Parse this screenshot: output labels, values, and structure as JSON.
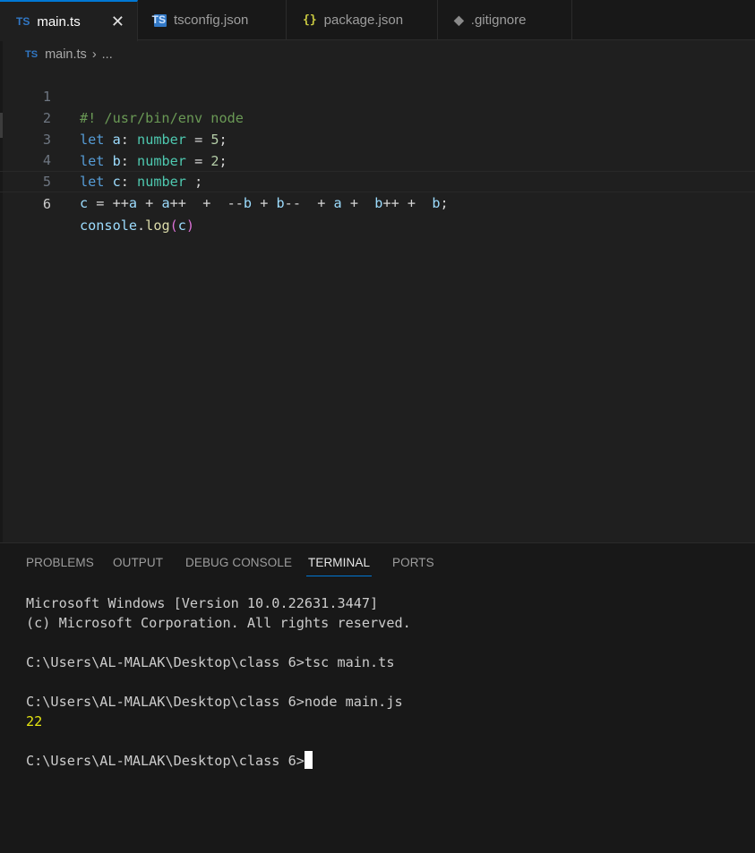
{
  "tabs": [
    {
      "icon": "TS",
      "label": "main.ts",
      "active": true,
      "close": "✕"
    },
    {
      "icon": "TS",
      "label": "tsconfig.json",
      "active": false
    },
    {
      "icon": "{}",
      "label": "package.json",
      "active": false
    },
    {
      "icon": "◆",
      "label": ".gitignore",
      "active": false
    }
  ],
  "breadcrumb": {
    "icon": "TS",
    "file": "main.ts",
    "separator": "›",
    "rest": "..."
  },
  "editor": {
    "line_numbers": [
      "1",
      "2",
      "3",
      "4",
      "5",
      "6"
    ],
    "current_line": "6",
    "lines": [
      [
        {
          "t": "#! /usr/bin/env node",
          "c": "c-comment"
        }
      ],
      [
        {
          "t": "let",
          "c": "c-kw"
        },
        {
          "t": " ",
          "c": ""
        },
        {
          "t": "a",
          "c": "c-var"
        },
        {
          "t": ": ",
          "c": "c-op"
        },
        {
          "t": "number",
          "c": "c-type"
        },
        {
          "t": " = ",
          "c": "c-op"
        },
        {
          "t": "5",
          "c": "c-num"
        },
        {
          "t": ";",
          "c": "c-op"
        }
      ],
      [
        {
          "t": "let",
          "c": "c-kw"
        },
        {
          "t": " ",
          "c": ""
        },
        {
          "t": "b",
          "c": "c-var"
        },
        {
          "t": ": ",
          "c": "c-op"
        },
        {
          "t": "number",
          "c": "c-type"
        },
        {
          "t": " = ",
          "c": "c-op"
        },
        {
          "t": "2",
          "c": "c-num"
        },
        {
          "t": ";",
          "c": "c-op"
        }
      ],
      [
        {
          "t": "let",
          "c": "c-kw"
        },
        {
          "t": " ",
          "c": ""
        },
        {
          "t": "c",
          "c": "c-var"
        },
        {
          "t": ": ",
          "c": "c-op"
        },
        {
          "t": "number",
          "c": "c-type"
        },
        {
          "t": " ;",
          "c": "c-op"
        }
      ],
      [
        {
          "t": "c",
          "c": "c-var"
        },
        {
          "t": " = ++",
          "c": "c-op"
        },
        {
          "t": "a",
          "c": "c-var"
        },
        {
          "t": " + ",
          "c": "c-op"
        },
        {
          "t": "a",
          "c": "c-var"
        },
        {
          "t": "++  +  --",
          "c": "c-op"
        },
        {
          "t": "b",
          "c": "c-var"
        },
        {
          "t": " + ",
          "c": "c-op"
        },
        {
          "t": "b",
          "c": "c-var"
        },
        {
          "t": "--  + ",
          "c": "c-op"
        },
        {
          "t": "a",
          "c": "c-var"
        },
        {
          "t": " +  ",
          "c": "c-op"
        },
        {
          "t": "b",
          "c": "c-var"
        },
        {
          "t": "++ +  ",
          "c": "c-op"
        },
        {
          "t": "b",
          "c": "c-var"
        },
        {
          "t": ";",
          "c": "c-op"
        }
      ],
      [
        {
          "t": "console",
          "c": "c-var"
        },
        {
          "t": ".",
          "c": "c-op"
        },
        {
          "t": "log",
          "c": "c-fn"
        },
        {
          "t": "(",
          "c": "c-paren"
        },
        {
          "t": "c",
          "c": "c-var"
        },
        {
          "t": ")",
          "c": "c-paren"
        }
      ]
    ]
  },
  "panel": {
    "tabs": [
      "PROBLEMS",
      "OUTPUT",
      "DEBUG CONSOLE",
      "TERMINAL",
      "PORTS"
    ],
    "active_tab": "TERMINAL",
    "terminal_lines": [
      "Microsoft Windows [Version 10.0.22631.3447]",
      "(c) Microsoft Corporation. All rights reserved.",
      "",
      "C:\\Users\\AL-MALAK\\Desktop\\class 6>tsc main.ts",
      "",
      "C:\\Users\\AL-MALAK\\Desktop\\class 6>node main.js",
      "22",
      "",
      "C:\\Users\\AL-MALAK\\Desktop\\class 6>"
    ]
  },
  "colors": {
    "accent": "#0078d4",
    "ts_blue": "#3178c6",
    "terminal_result": "#e5e510"
  }
}
